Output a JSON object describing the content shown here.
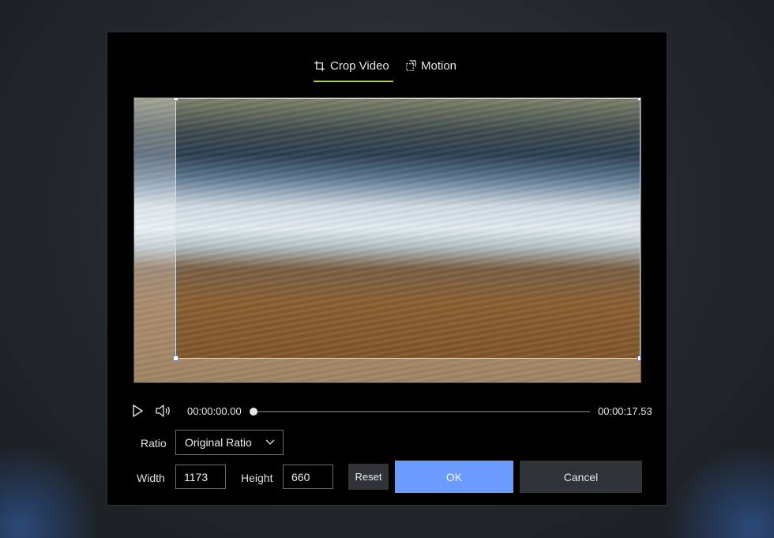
{
  "tabs": [
    {
      "label": "Crop Video",
      "icon": "crop-icon",
      "active": true
    },
    {
      "label": "Motion",
      "icon": "motion-icon",
      "active": false
    }
  ],
  "player": {
    "current_time": "00:00:00.00",
    "total_time": "00:00:17.53",
    "progress": 0.0
  },
  "ratio": {
    "label": "Ratio",
    "selected": "Original Ratio"
  },
  "size": {
    "width_label": "Width",
    "width_value": "1173",
    "height_label": "Height",
    "height_value": "660"
  },
  "buttons": {
    "reset": "Reset",
    "ok": "OK",
    "cancel": "Cancel"
  },
  "colors": {
    "accent_tab": "#a8d34a",
    "ok_button": "#6a9bff"
  }
}
